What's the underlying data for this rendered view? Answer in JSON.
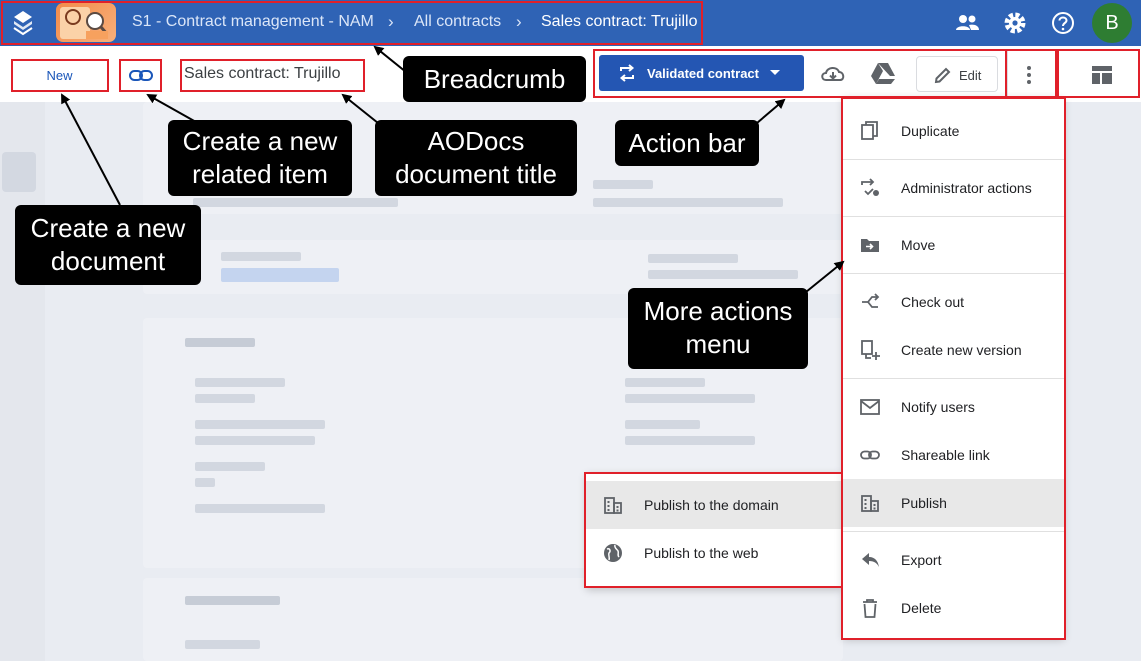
{
  "header": {
    "app_icon": "aodocs-logo-icon",
    "library_thumbnail": "library-thumbnail",
    "breadcrumb": [
      "S1 - Contract management - NAM",
      "All contracts",
      "Sales contract: Trujillo"
    ],
    "icons": [
      "people-icon",
      "gear-icon",
      "help-icon"
    ],
    "avatar_letter": "B"
  },
  "toolbar": {
    "new_label": "New",
    "link_icon": "link-icon",
    "doc_title": "Sales contract: Trujillo",
    "status_label": "Validated contract",
    "status_icon": "workflow-icon",
    "download_icon": "cloud-download-icon",
    "drive_icon": "google-drive-icon",
    "edit_label": "Edit",
    "more_icon": "more-vert-icon",
    "layout_icon": "layout-icon"
  },
  "more_menu": {
    "items": [
      {
        "label": "Duplicate",
        "icon": "duplicate-icon"
      },
      {
        "label": "Administrator actions",
        "icon": "admin-actions-icon"
      },
      {
        "label": "Move",
        "icon": "move-folder-icon"
      },
      {
        "label": "Check out",
        "icon": "check-out-icon"
      },
      {
        "label": "Create new version",
        "icon": "new-version-icon"
      },
      {
        "label": "Notify users",
        "icon": "mail-icon"
      },
      {
        "label": "Shareable link",
        "icon": "link-icon"
      },
      {
        "label": "Publish",
        "icon": "domain-icon"
      },
      {
        "label": "Export",
        "icon": "reply-icon"
      },
      {
        "label": "Delete",
        "icon": "trash-icon"
      }
    ]
  },
  "publish_submenu": {
    "items": [
      {
        "label": "Publish to the domain",
        "icon": "domain-icon"
      },
      {
        "label": "Publish to the web",
        "icon": "globe-icon"
      }
    ]
  },
  "callouts": {
    "breadcrumb": "Breadcrumb",
    "create_related": "Create a new related item",
    "doc_title": "AODocs document title",
    "action_bar": "Action bar",
    "create_new_doc": "Create a new document",
    "more_actions": "More actions menu"
  },
  "colors": {
    "header_blue": "#2f63b5",
    "primary_button": "#2456b3",
    "annotation_red": "#e0202a",
    "callout_black": "#000000",
    "avatar_green": "#2e7d32"
  }
}
